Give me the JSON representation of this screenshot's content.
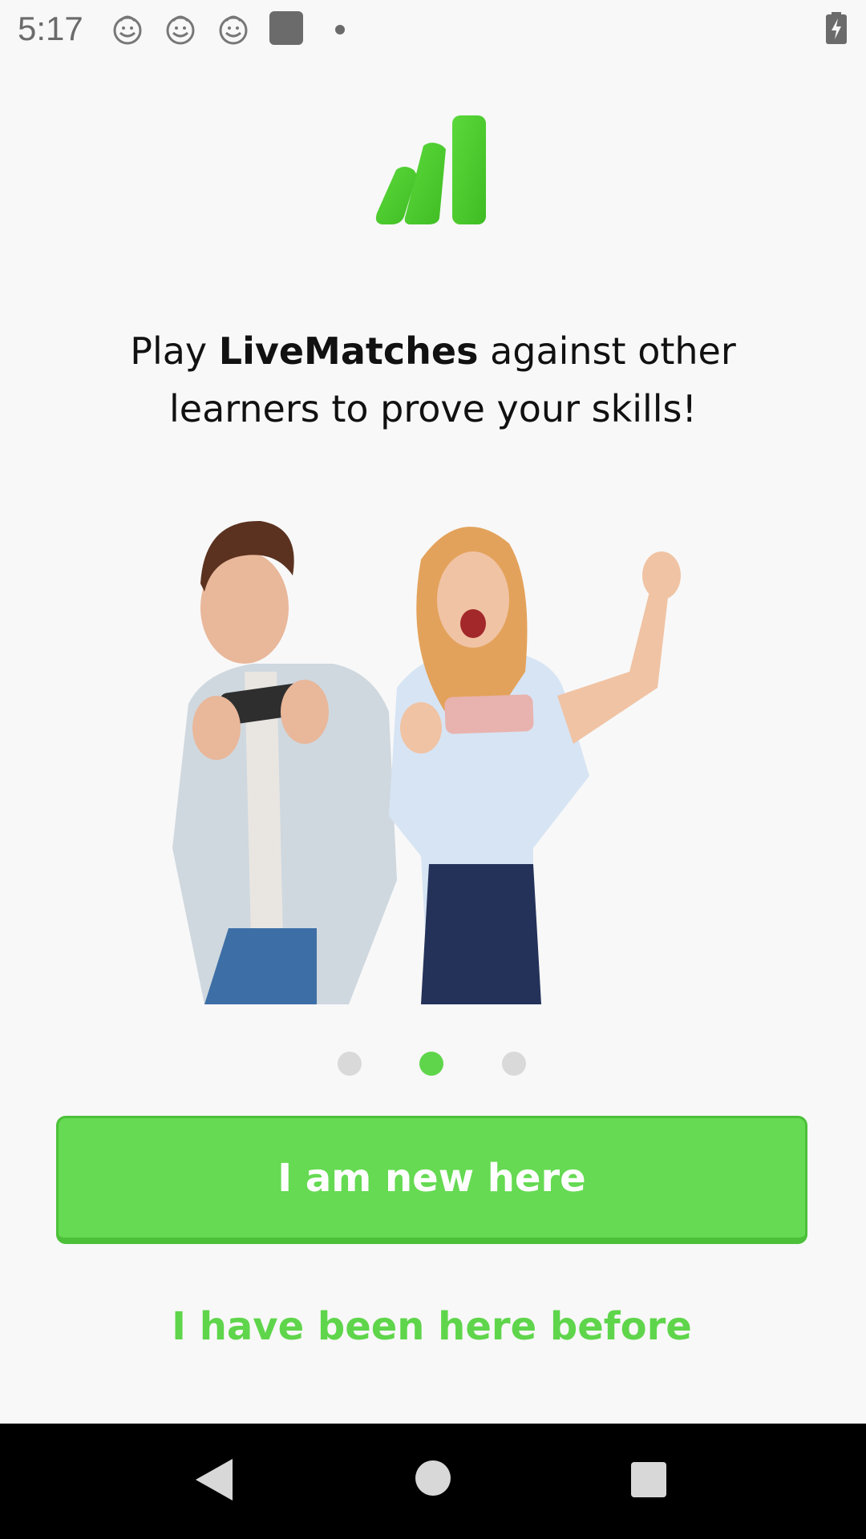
{
  "status_bar": {
    "time": "5:17",
    "icons": [
      "notification-face-icon",
      "notification-face-icon",
      "notification-face-icon",
      "square-app-icon",
      "dot-icon",
      "battery-charging-icon"
    ]
  },
  "logo": {
    "icon": "bars-logo-icon",
    "color": "#4cc92f"
  },
  "headline": {
    "prefix": "Play ",
    "brand": "LiveMatches",
    "suffix": " against other learners to prove your skills!"
  },
  "hero": {
    "icon": "two-people-playing-phones-illustration"
  },
  "pager": {
    "count": 3,
    "active_index": 1,
    "active_color": "#5fd54b",
    "inactive_color": "#d9d9d9"
  },
  "buttons": {
    "primary_label": "I am new here",
    "secondary_label": "I have been here before",
    "accent": "#65da52"
  },
  "nav_bar": {
    "icons": [
      "back-icon",
      "home-icon",
      "recents-icon"
    ]
  }
}
